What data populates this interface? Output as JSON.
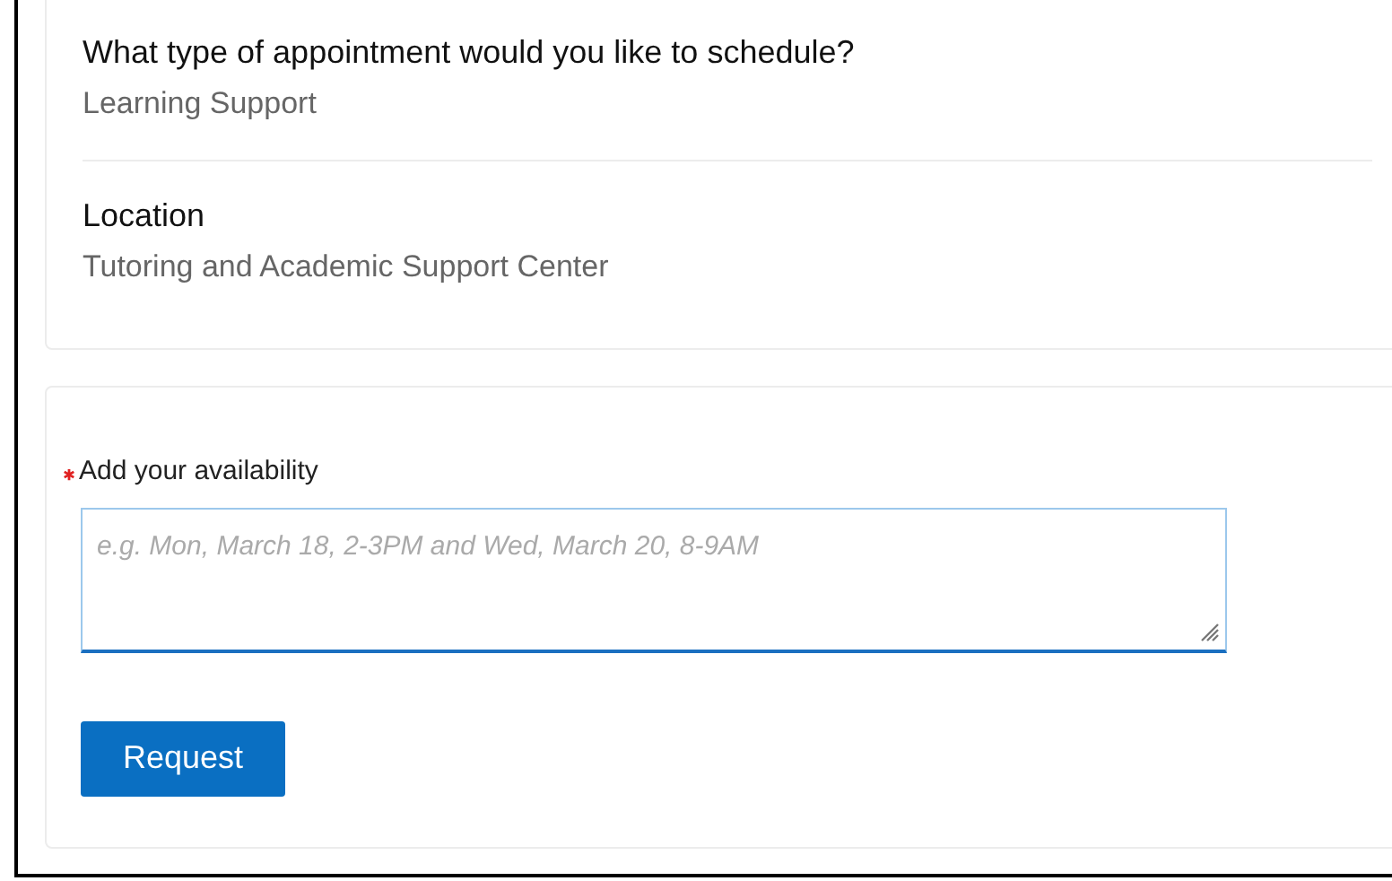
{
  "details": [
    {
      "label": "What type of appointment would you like to schedule?",
      "value": "Learning Support"
    },
    {
      "label": "Location",
      "value": "Tutoring and Academic Support Center"
    }
  ],
  "availability": {
    "label": "Add your availability",
    "required": true,
    "placeholder": "e.g. Mon, March 18, 2-3PM and Wed, March 20, 8-9AM"
  },
  "submit": {
    "label": "Request"
  }
}
